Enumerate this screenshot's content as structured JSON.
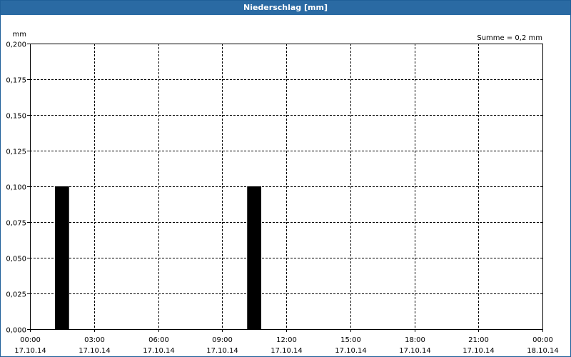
{
  "window": {
    "title": "Niederschlag [mm]"
  },
  "chart_data": {
    "type": "bar",
    "title": "Niederschlag [mm]",
    "ylabel": "mm",
    "annotation": "Summe = 0,2 mm",
    "ylim": [
      0,
      0.2
    ],
    "y_ticks": [
      "0,000",
      "0,025",
      "0,050",
      "0,075",
      "0,100",
      "0,125",
      "0,150",
      "0,175",
      "0,200"
    ],
    "x_ticks": [
      {
        "time": "00:00",
        "date": "17.10.14"
      },
      {
        "time": "03:00",
        "date": "17.10.14"
      },
      {
        "time": "06:00",
        "date": "17.10.14"
      },
      {
        "time": "09:00",
        "date": "17.10.14"
      },
      {
        "time": "12:00",
        "date": "17.10.14"
      },
      {
        "time": "15:00",
        "date": "17.10.14"
      },
      {
        "time": "18:00",
        "date": "17.10.14"
      },
      {
        "time": "21:00",
        "date": "17.10.14"
      },
      {
        "time": "00:00",
        "date": "18.10.14"
      }
    ],
    "x_range_hours": [
      0,
      24
    ],
    "bars": [
      {
        "start_hour": 1.17,
        "end_hour": 1.83,
        "value": 0.1
      },
      {
        "start_hour": 10.17,
        "end_hour": 10.83,
        "value": 0.1
      }
    ],
    "grid": true,
    "bar_color": "#000000"
  }
}
